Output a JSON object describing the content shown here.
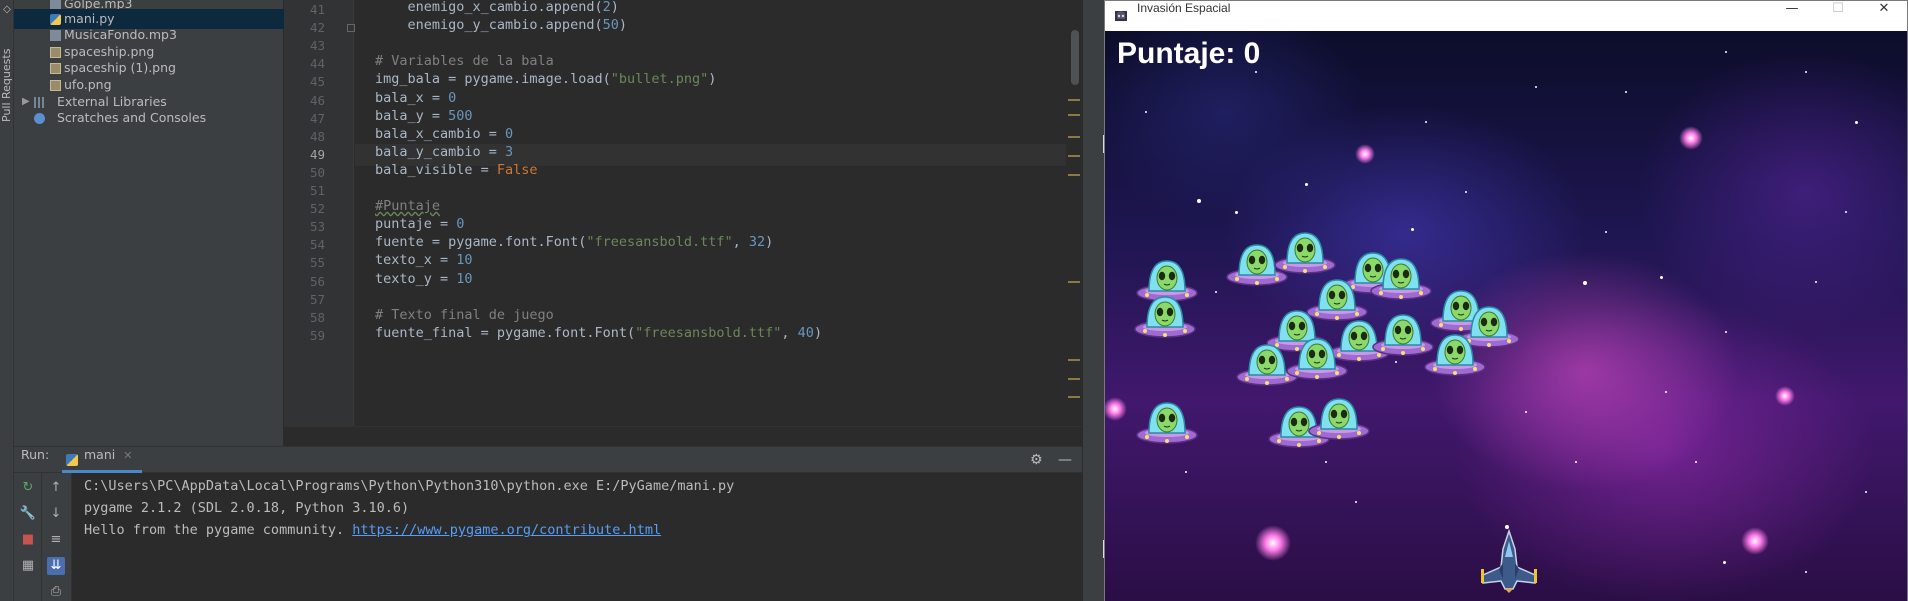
{
  "sidebar": {
    "vertical_label": "Pull Requests"
  },
  "project_tree": {
    "items": [
      {
        "label": "Golpe.mp3",
        "kind": "mp3"
      },
      {
        "label": "mani.py",
        "kind": "py",
        "selected": true
      },
      {
        "label": "MusicaFondo.mp3",
        "kind": "mp3"
      },
      {
        "label": "spaceship.png",
        "kind": "png"
      },
      {
        "label": "spaceship (1).png",
        "kind": "png"
      },
      {
        "label": "ufo.png",
        "kind": "png"
      },
      {
        "label": "External Libraries",
        "kind": "lib"
      },
      {
        "label": "Scratches and Consoles",
        "kind": "scratch"
      }
    ]
  },
  "editor": {
    "current_line": 49,
    "lines": [
      {
        "n": 41,
        "text": "    enemigo_x_cambio.append(2)"
      },
      {
        "n": 42,
        "text": "    enemigo_y_cambio.append(50)"
      },
      {
        "n": 43,
        "text": ""
      },
      {
        "n": 44,
        "text": "# Variables de la bala"
      },
      {
        "n": 45,
        "text": "img_bala = pygame.image.load(\"bullet.png\")"
      },
      {
        "n": 46,
        "text": "bala_x = 0"
      },
      {
        "n": 47,
        "text": "bala_y = 500"
      },
      {
        "n": 48,
        "text": "bala_x_cambio = 0"
      },
      {
        "n": 49,
        "text": "bala_y_cambio = 3"
      },
      {
        "n": 50,
        "text": "bala_visible = False"
      },
      {
        "n": 51,
        "text": ""
      },
      {
        "n": 52,
        "text": "#Puntaje"
      },
      {
        "n": 53,
        "text": "puntaje = 0"
      },
      {
        "n": 54,
        "text": "fuente = pygame.font.Font(\"freesansbold.ttf\", 32)"
      },
      {
        "n": 55,
        "text": "texto_x = 10"
      },
      {
        "n": 56,
        "text": "texto_y = 10"
      },
      {
        "n": 57,
        "text": ""
      },
      {
        "n": 58,
        "text": "# Texto final de juego"
      },
      {
        "n": 59,
        "text": "fuente_final = pygame.font.Font(\"freesansbold.ttf\", 40)"
      }
    ]
  },
  "run_panel": {
    "label": "Run:",
    "tab_label": "mani",
    "console": [
      {
        "text": "C:\\Users\\PC\\AppData\\Local\\Programs\\Python\\Python310\\python.exe E:/PyGame/mani.py"
      },
      {
        "text": "pygame 2.1.2 (SDL 2.0.18, Python 3.10.6)"
      },
      {
        "text": "Hello from the pygame community. ",
        "link": "https://www.pygame.org/contribute.html"
      }
    ]
  },
  "game_window": {
    "title": "Invasión Espacial",
    "score_label": "Puntaje: 0",
    "controls": {
      "minimize": "—",
      "maximize": "☐",
      "close": "✕"
    }
  },
  "colors": {
    "ide_bg": "#2b2b2b",
    "panel_bg": "#3c3f41",
    "keyword": "#cc7832",
    "number": "#6897bb",
    "string": "#6a8759",
    "comment": "#808080",
    "link": "#589df6"
  }
}
